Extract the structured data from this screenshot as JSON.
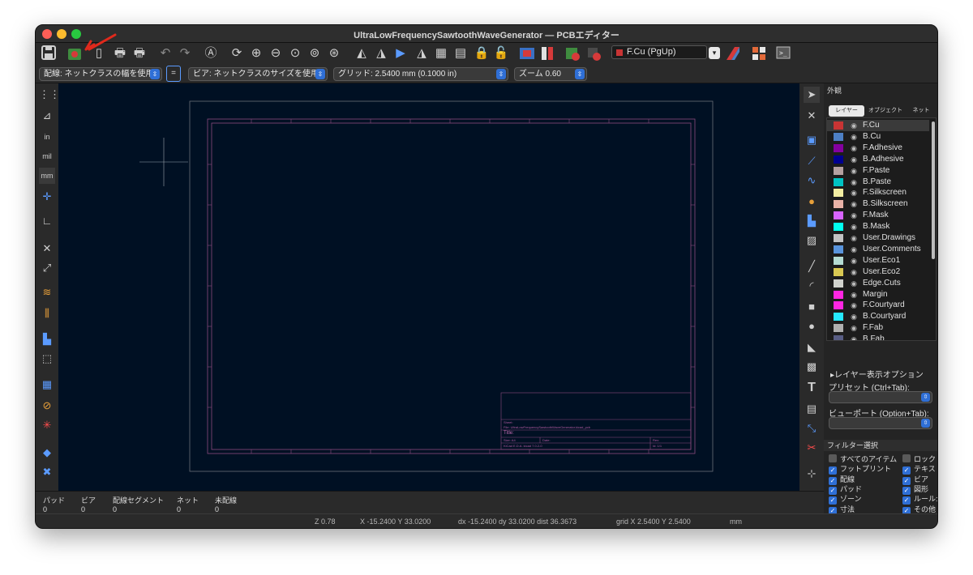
{
  "window": {
    "title": "UltraLowFrequencySawtoothWaveGenerator — PCBエディター"
  },
  "toolbar": {
    "layer_select": "F.Cu (PgUp)",
    "layer_color": "#c83434"
  },
  "options": {
    "track": "配線: ネットクラスの幅を使用",
    "via": "ビア: ネットクラスのサイズを使用",
    "grid": "グリッド: 2.5400 mm (0.1000 in)",
    "zoom": "ズーム 0.60"
  },
  "canvas": {
    "title_block": {
      "sheet": "Sheet:",
      "file": "File: UltraLowFrequencySawtoothWaveGenerator.kicad_pcb",
      "title": "Title:",
      "size": "Size: A4",
      "date": "Date:",
      "rev": "Rev:",
      "kicad": "KiCad E.D.A.  kicad 7.0.2-0",
      "id": "Id: 1/1"
    }
  },
  "appearance": {
    "header": "外観",
    "tabs": [
      "レイヤー",
      "オブジェクト",
      "ネット"
    ],
    "layers": [
      {
        "name": "F.Cu",
        "color": "#c83434"
      },
      {
        "name": "B.Cu",
        "color": "#4d7fc4"
      },
      {
        "name": "F.Adhesive",
        "color": "#84009f"
      },
      {
        "name": "B.Adhesive",
        "color": "#00008f"
      },
      {
        "name": "F.Paste",
        "color": "#b4a0a0"
      },
      {
        "name": "B.Paste",
        "color": "#00c2c2"
      },
      {
        "name": "F.Silkscreen",
        "color": "#f2eda1"
      },
      {
        "name": "B.Silkscreen",
        "color": "#e8b2a7"
      },
      {
        "name": "F.Mask",
        "color": "#d864ff"
      },
      {
        "name": "B.Mask",
        "color": "#02ffee"
      },
      {
        "name": "User.Drawings",
        "color": "#c2c2c2"
      },
      {
        "name": "User.Comments",
        "color": "#5994dc"
      },
      {
        "name": "User.Eco1",
        "color": "#b4dbd2"
      },
      {
        "name": "User.Eco2",
        "color": "#d8c852"
      },
      {
        "name": "Edge.Cuts",
        "color": "#d0d2cd"
      },
      {
        "name": "Margin",
        "color": "#ff26e2"
      },
      {
        "name": "F.Courtyard",
        "color": "#ff26e2"
      },
      {
        "name": "B.Courtyard",
        "color": "#26e9ff"
      },
      {
        "name": "F.Fab",
        "color": "#afafaf"
      },
      {
        "name": "B.Fab",
        "color": "#585d84"
      }
    ],
    "layer_options": "▸レイヤー表示オプション",
    "preset_label": "プリセット (Ctrl+Tab):",
    "viewport_label": "ビューポート (Option+Tab):"
  },
  "filter": {
    "header": "フィルター選択",
    "items": [
      {
        "label": "すべてのアイテム",
        "checked": false
      },
      {
        "label": "ロック",
        "checked": false
      },
      {
        "label": "フットプリント",
        "checked": true
      },
      {
        "label": "テキス",
        "checked": true
      },
      {
        "label": "配線",
        "checked": true
      },
      {
        "label": "ビア",
        "checked": true
      },
      {
        "label": "パッド",
        "checked": true
      },
      {
        "label": "図形",
        "checked": true
      },
      {
        "label": "ゾーン",
        "checked": true
      },
      {
        "label": "ルール:",
        "checked": true
      },
      {
        "label": "寸法",
        "checked": true
      },
      {
        "label": "その他",
        "checked": true
      }
    ]
  },
  "status": {
    "labels": [
      "パッド",
      "ビア",
      "配線セグメント",
      "ネット",
      "未配線"
    ],
    "values": [
      "0",
      "0",
      "0",
      "0",
      "0"
    ]
  },
  "coords": {
    "zoom": "Z 0.78",
    "xy": "X -15.2400  Y 33.0200",
    "delta": "dx -15.2400  dy 33.0200  dist 36.3673",
    "grid": "grid X 2.5400  Y 2.5400",
    "units": "mm"
  }
}
